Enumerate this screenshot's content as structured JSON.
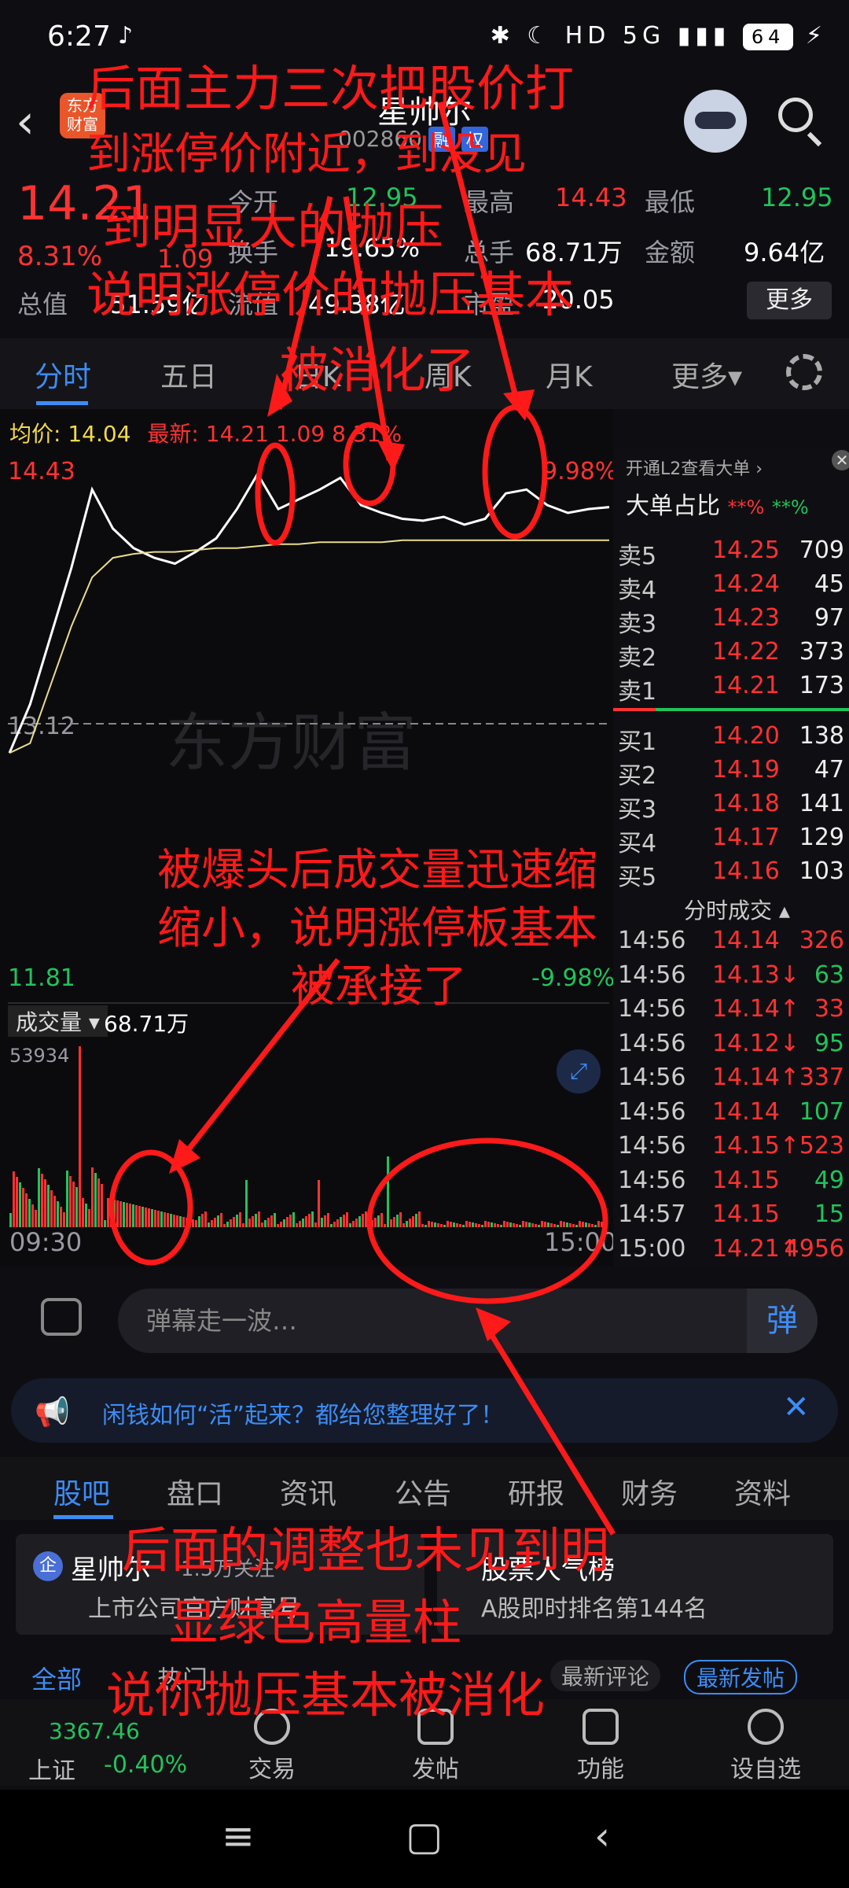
{
  "status_bar": {
    "time": "6:27",
    "battery": "64"
  },
  "header": {
    "stock_name": "星帅尔",
    "stock_code": "002860",
    "badge1": "融",
    "badge2": "权"
  },
  "quote": {
    "price": "14.21",
    "change": "1.09",
    "change_pct": "8.31%",
    "open_label": "今开",
    "open": "12.95",
    "high_label": "最高",
    "high": "14.43",
    "low_label": "最低",
    "low": "12.95",
    "turnover_label": "换手",
    "turnover": "19.65%",
    "volume_label": "总手",
    "volume": "68.71万",
    "amount_label": "金额",
    "amount": "9.64亿",
    "mktcap_label": "总值",
    "mktcap": "51.59亿",
    "float_label": "流值",
    "float": "49.38亿",
    "pe_label": "市盈",
    "pe": "20.05",
    "more_label": "更多"
  },
  "tabs": [
    "分时",
    "五日",
    "日K",
    "周K",
    "月K",
    "更多"
  ],
  "chart": {
    "avg_label": "均价:",
    "avg_value": "14.04",
    "latest_label": "最新:",
    "latest_value": "14.21",
    "latest_change": "1.09",
    "latest_pct": "8.31%",
    "y_top": "14.43",
    "y_mid": "13.12",
    "y_bottom": "11.81",
    "pct_top": "9.98%",
    "pct_bottom": "-9.98%",
    "watermark": "东方财富",
    "volume_label": "成交量",
    "volume_value": "68.71万",
    "vol_max": "53934",
    "time_start": "09:30",
    "time_end": "15:00"
  },
  "chart_data": {
    "type": "line",
    "title": "",
    "series": [
      {
        "name": "",
        "values": [
          12.95,
          13.2,
          13.55,
          13.9,
          14.3,
          14.1,
          14.0,
          13.95,
          13.92,
          13.98,
          14.05,
          14.2,
          14.38,
          14.2,
          14.25,
          14.3,
          14.36,
          14.22,
          14.18,
          14.15,
          14.14,
          14.16,
          14.12,
          14.15,
          14.28,
          14.3,
          14.22,
          14.18,
          14.2,
          14.21
        ]
      },
      {
        "name": "均价",
        "values": [
          12.95,
          13.0,
          13.3,
          13.6,
          13.85,
          13.95,
          13.97,
          13.98,
          13.98,
          13.99,
          14.0,
          14.0,
          14.01,
          14.02,
          14.02,
          14.03,
          14.03,
          14.03,
          14.03,
          14.04,
          14.04,
          14.04,
          14.04,
          14.04,
          14.04,
          14.04,
          14.04,
          14.04,
          14.04,
          14.04
        ]
      }
    ],
    "ylim": [
      11.81,
      14.43
    ],
    "xlabel": "",
    "ylabel": ""
  },
  "order_book": {
    "top_hint": "开通L2查看大单",
    "big_label": "大单占比",
    "big_red": "**%",
    "big_green": "**%",
    "asks": [
      {
        "label": "卖5",
        "price": "14.25",
        "vol": "709"
      },
      {
        "label": "卖4",
        "price": "14.24",
        "vol": "45"
      },
      {
        "label": "卖3",
        "price": "14.23",
        "vol": "97"
      },
      {
        "label": "卖2",
        "price": "14.22",
        "vol": "373"
      },
      {
        "label": "卖1",
        "price": "14.21",
        "vol": "173"
      }
    ],
    "bids": [
      {
        "label": "买1",
        "price": "14.20",
        "vol": "138"
      },
      {
        "label": "买2",
        "price": "14.19",
        "vol": "47"
      },
      {
        "label": "买3",
        "price": "14.18",
        "vol": "141"
      },
      {
        "label": "买4",
        "price": "14.17",
        "vol": "129"
      },
      {
        "label": "买5",
        "price": "14.16",
        "vol": "103"
      }
    ],
    "ticks_title": "分时成交",
    "ticks": [
      {
        "time": "14:56",
        "price": "14.14",
        "vol": "326"
      },
      {
        "time": "14:56",
        "price": "14.13↓",
        "vol": "63"
      },
      {
        "time": "14:56",
        "price": "14.14↑",
        "vol": "33"
      },
      {
        "time": "14:56",
        "price": "14.12↓",
        "vol": "95"
      },
      {
        "time": "14:56",
        "price": "14.14↑",
        "vol": "337"
      },
      {
        "time": "14:56",
        "price": "14.14",
        "vol": "107"
      },
      {
        "time": "14:56",
        "price": "14.15↑",
        "vol": "523"
      },
      {
        "time": "14:56",
        "price": "14.15",
        "vol": "49"
      },
      {
        "time": "14:57",
        "price": "14.15",
        "vol": "15"
      },
      {
        "time": "15:00",
        "price": "14.21↑",
        "vol": "4956"
      }
    ]
  },
  "danmu": {
    "placeholder": "弹幕走一波…",
    "button": "弹"
  },
  "banner": {
    "text": "闲钱如何“活”起来？都给您整理好了！"
  },
  "bottom_tabs": [
    "股吧",
    "盘口",
    "资讯",
    "公告",
    "研报",
    "财务",
    "资料"
  ],
  "cards": {
    "left_title": "星帅尔",
    "left_follow": "1.5万关注",
    "left_sub": "上市公司官方财富号",
    "right_title": "股票人气榜",
    "right_sub": "A股即时排名第144名"
  },
  "sub_tabs": {
    "all": "全部",
    "hot": "热门",
    "sort": "最新评论",
    "post": "最新发帖"
  },
  "nav": {
    "index_name": "上证",
    "index_value": "3367.46",
    "index_change": "-0.40%",
    "items": [
      "交易",
      "发帖",
      "功能",
      "设自选"
    ]
  },
  "annotations": {
    "a1": "后面主力三次把股价打",
    "a2": "到涨停价附近，到没见",
    "a3": "到明显大的抛压",
    "a4": "说明涨停价的抛压基本",
    "a5": "被消化了",
    "b1": "被爆头后成交量迅速缩",
    "b2": "缩小，说明涨停板基本",
    "b3": "被承接了",
    "c1": "后面的调整也未见到明",
    "c2": "显绿色高量柱",
    "c3": "说你抛压基本被消化"
  }
}
